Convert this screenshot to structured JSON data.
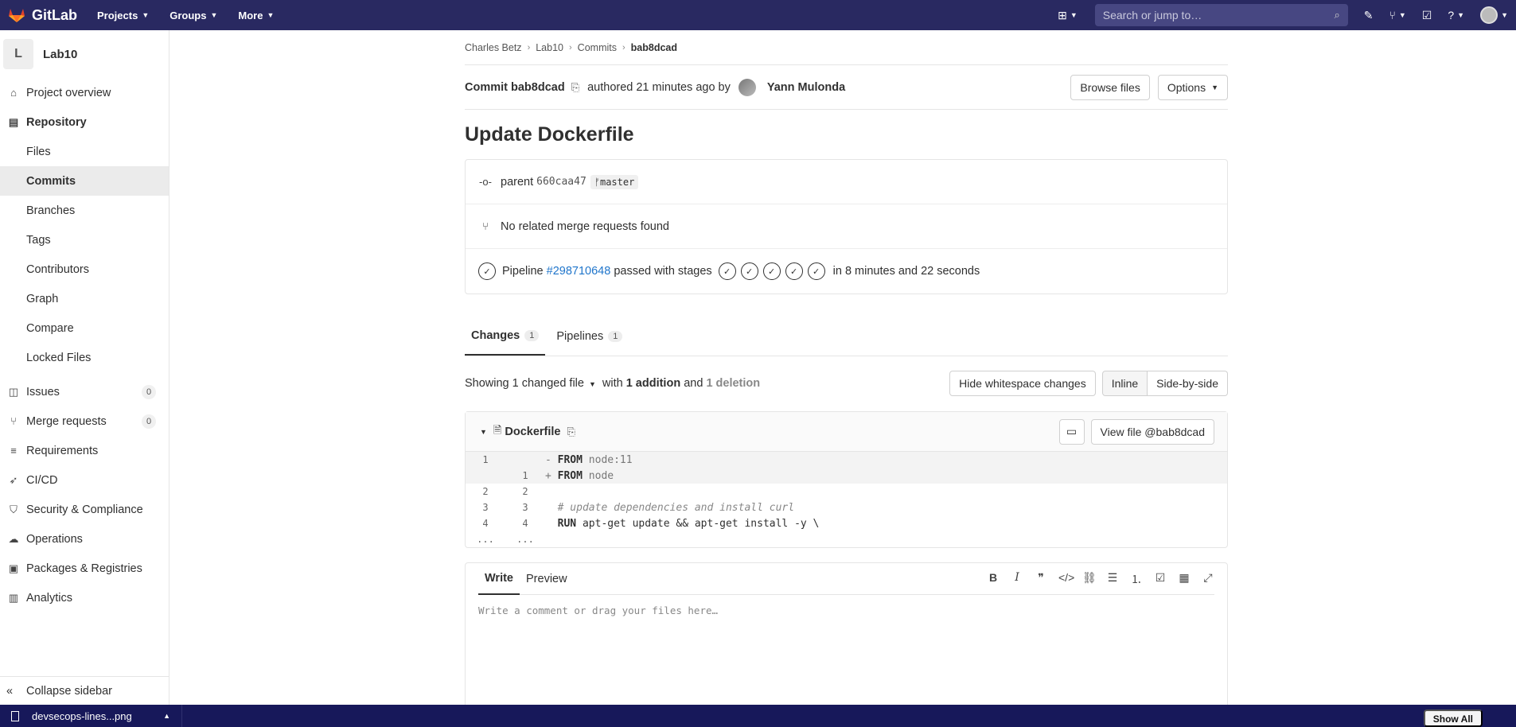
{
  "topbar": {
    "brand": "GitLab",
    "nav": [
      {
        "label": "Projects"
      },
      {
        "label": "Groups"
      },
      {
        "label": "More"
      }
    ],
    "search_placeholder": "Search or jump to…"
  },
  "sidebar": {
    "project_letter": "L",
    "project_name": "Lab10",
    "overview": "Project overview",
    "repository": "Repository",
    "repo_items": [
      "Files",
      "Commits",
      "Branches",
      "Tags",
      "Contributors",
      "Graph",
      "Compare",
      "Locked Files"
    ],
    "issues": "Issues",
    "issues_count": "0",
    "merge_requests": "Merge requests",
    "mr_count": "0",
    "requirements": "Requirements",
    "cicd": "CI/CD",
    "security": "Security & Compliance",
    "operations": "Operations",
    "packages": "Packages & Registries",
    "analytics": "Analytics",
    "collapse": "Collapse sidebar"
  },
  "breadcrumb": {
    "owner": "Charles Betz",
    "project": "Lab10",
    "section": "Commits",
    "current": "bab8dcad"
  },
  "commit": {
    "label": "Commit bab8dcad",
    "authored": "authored 21 minutes ago by",
    "author": "Yann Mulonda",
    "browse_files": "Browse files",
    "options": "Options",
    "title": "Update Dockerfile",
    "parent_label": "parent",
    "parent_sha": "660caa47",
    "branch": "master",
    "no_mr": "No related merge requests found",
    "pipeline_label": "Pipeline",
    "pipeline_id": "#298710648",
    "pipeline_status": "passed with stages",
    "pipeline_duration": "in 8 minutes and 22 seconds",
    "stages_passed": 5
  },
  "tabs": {
    "changes": "Changes",
    "changes_count": "1",
    "pipelines": "Pipelines",
    "pipelines_count": "1"
  },
  "changes_bar": {
    "showing": "Showing",
    "changed_file": "1 changed file",
    "with": "with",
    "addition": "1 addition",
    "and": "and",
    "deletion": "1 deletion",
    "hide_whitespace": "Hide whitespace changes",
    "inline": "Inline",
    "side_by_side": "Side-by-side"
  },
  "diff": {
    "filename": "Dockerfile",
    "view_file": "View file @bab8dcad",
    "lines": [
      {
        "old": "1",
        "new": "",
        "sign": "-",
        "kw": "FROM",
        "rest": " node:11"
      },
      {
        "old": "",
        "new": "1",
        "sign": "+",
        "kw": "FROM",
        "rest": " node"
      },
      {
        "old": "2",
        "new": "2",
        "sign": "",
        "kw": "",
        "rest": ""
      },
      {
        "old": "3",
        "new": "3",
        "sign": "",
        "kw": "",
        "rest": "# update dependencies and install curl"
      },
      {
        "old": "4",
        "new": "4",
        "sign": "",
        "kw": "RUN",
        "rest": " apt-get update && apt-get install -y \\"
      },
      {
        "old": "...",
        "new": "...",
        "sign": "",
        "kw": "",
        "rest": ""
      }
    ]
  },
  "comment": {
    "write": "Write",
    "preview": "Preview",
    "placeholder": "Write a comment or drag your files here…"
  },
  "taskbar": {
    "file": "devsecops-lines...png",
    "show_all": "Show All"
  }
}
